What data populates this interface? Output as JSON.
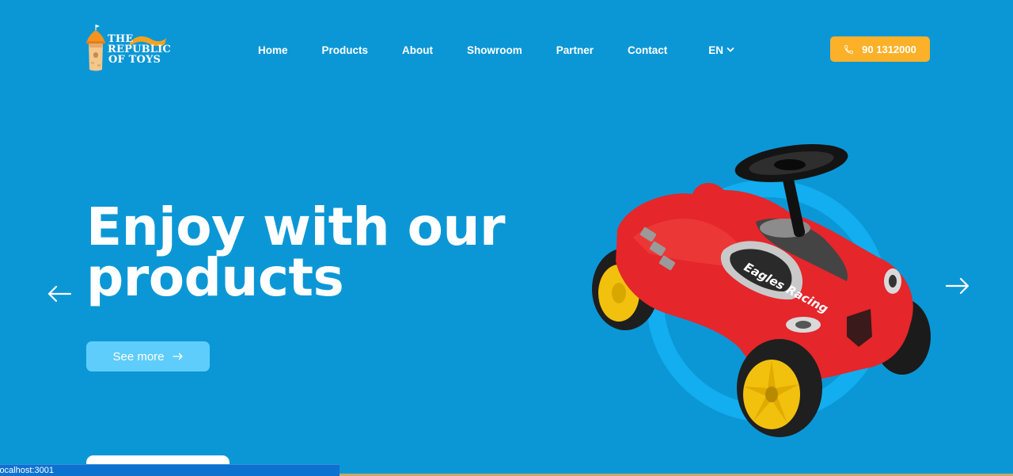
{
  "brand": {
    "line1": "THE",
    "line2": "REPUBLIC",
    "line3": "OF TOYS",
    "icon": "castle-tower-logo"
  },
  "nav": {
    "items": [
      "Home",
      "Products",
      "About",
      "Showroom",
      "Partner",
      "Contact"
    ],
    "language": "EN",
    "language_icon": "chevron-down-icon"
  },
  "phone": {
    "label": "90 1312000",
    "icon": "phone-icon"
  },
  "hero": {
    "title_line1": "Enjoy with our",
    "title_line2": "products",
    "cta_label": "See more",
    "cta_icon": "arrow-right-icon",
    "prev_icon": "arrow-left-icon",
    "next_icon": "arrow-right-icon",
    "image": "red-ride-on-toy-car"
  },
  "car_decal": "Eagles Racing",
  "status_bar": {
    "text": "localhost:3001"
  },
  "colors": {
    "background": "#0b97d6",
    "accent_orange": "#fdb128",
    "cta_light_blue": "#5fcdfb",
    "car_red": "#e5262b",
    "wheel_yellow": "#f2c10d"
  }
}
